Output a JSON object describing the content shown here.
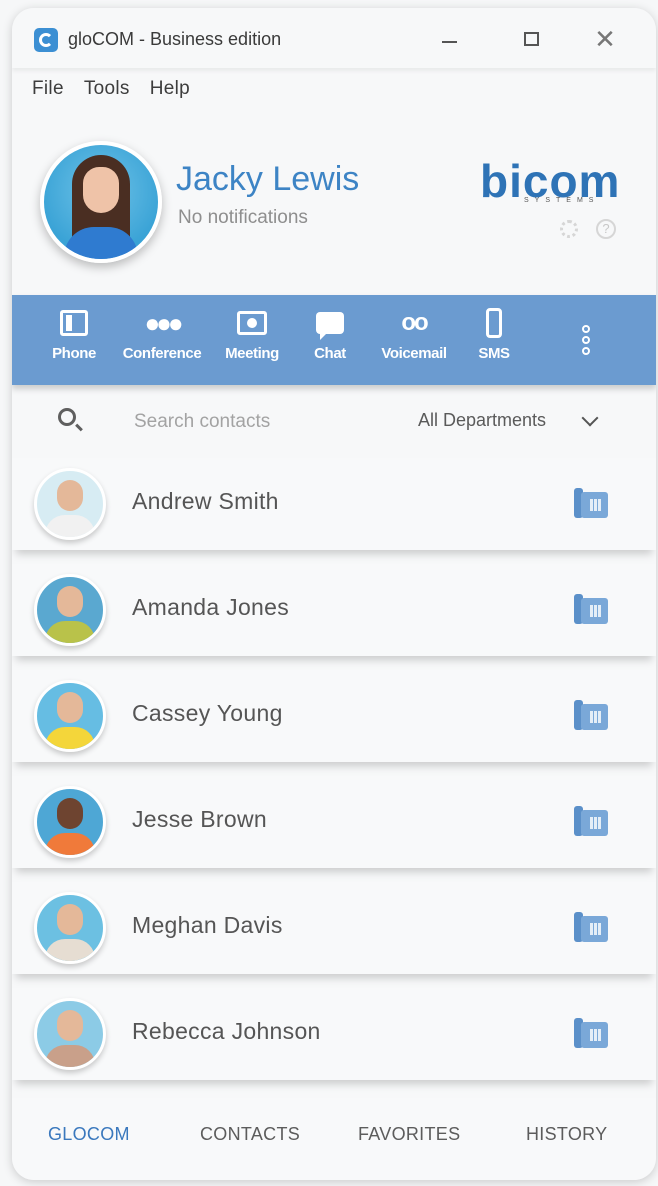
{
  "window": {
    "title": "gloCOM - Business edition",
    "controls": {
      "minimize": "–",
      "maximize": "□",
      "close": "✕"
    }
  },
  "menu": {
    "items": [
      "File",
      "Tools",
      "Help"
    ]
  },
  "profile": {
    "name": "Jacky Lewis",
    "status": "No notifications",
    "brand": "bicom",
    "brand_sub": "SYSTEMS"
  },
  "toolbar": {
    "items": [
      {
        "label": "Phone",
        "icon": "phone-icon"
      },
      {
        "label": "Conference",
        "icon": "conference-icon"
      },
      {
        "label": "Meeting",
        "icon": "meeting-icon"
      },
      {
        "label": "Chat",
        "icon": "chat-icon"
      },
      {
        "label": "Voicemail",
        "icon": "voicemail-icon"
      },
      {
        "label": "SMS",
        "icon": "sms-icon"
      }
    ],
    "more_icon": "more-vertical-icon"
  },
  "search": {
    "placeholder": "Search contacts",
    "department": "All Departments"
  },
  "contacts": [
    {
      "name": "Andrew Smith"
    },
    {
      "name": "Amanda Jones"
    },
    {
      "name": "Cassey Young"
    },
    {
      "name": "Jesse Brown"
    },
    {
      "name": "Meghan Davis"
    },
    {
      "name": "Rebecca Johnson"
    }
  ],
  "bottom_nav": {
    "items": [
      "GLOCOM",
      "CONTACTS",
      "FAVORITES",
      "HISTORY"
    ],
    "active": "GLOCOM"
  },
  "colors": {
    "accent": "#6b9bd0",
    "brand": "#2e73b6",
    "name": "#3d84c5"
  }
}
